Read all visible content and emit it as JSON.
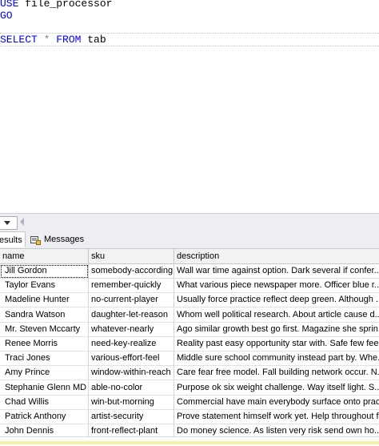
{
  "editor": {
    "line1": {
      "keyword": "USE",
      "rest": " file_processor"
    },
    "line2": {
      "keyword": "GO"
    },
    "line3": {
      "keyword1": "SELECT",
      "star": " * ",
      "keyword2": "FROM",
      "rest": " tab"
    }
  },
  "zoom": {
    "icon": "chevron-down-icon"
  },
  "tabs": {
    "results_label": "esults",
    "messages_label": "Messages",
    "messages_icon": "messages-icon"
  },
  "grid": {
    "columns": [
      "name",
      "sku",
      "description"
    ],
    "rows": [
      {
        "name": "Jill Gordon",
        "sku": "somebody-according",
        "description": "Wall war time against option. Dark several if confer..."
      },
      {
        "name": "Taylor Evans",
        "sku": "remember-quickly",
        "description": "What various piece newspaper more. Officer blue r..."
      },
      {
        "name": "Madeline Hunter",
        "sku": "no-current-player",
        "description": "Usually force practice reflect deep green. Although ..."
      },
      {
        "name": "Sandra Watson",
        "sku": "daughter-let-reason",
        "description": "Whom well political research. About article cause d..."
      },
      {
        "name": "Mr. Steven Mccarty",
        "sku": "whatever-nearly",
        "description": "Ago similar growth best go first. Magazine she sprin..."
      },
      {
        "name": "Renee Morris",
        "sku": "need-key-realize",
        "description": "Reality past easy opportunity star with. Safe few fee..."
      },
      {
        "name": "Traci Jones",
        "sku": "various-effort-feel",
        "description": "Middle sure school community instead part by. Whe..."
      },
      {
        "name": "Amy Prince",
        "sku": "window-within-reach",
        "description": "Care fear free model. Fall building network occur. N..."
      },
      {
        "name": "Stephanie Glenn MD",
        "sku": "able-no-color",
        "description": "Purpose ok six weight challenge. Way itself light. S..."
      },
      {
        "name": "Chad Willis",
        "sku": "win-but-morning",
        "description": "Commercial have main everybody surface onto prac..."
      },
      {
        "name": "Patrick Anthony",
        "sku": "artist-security",
        "description": "Prove statement himself work yet. Help throughout f..."
      },
      {
        "name": "John Dennis",
        "sku": "front-reflect-plant",
        "description": "Do money science. As listen very risk send own ho..."
      }
    ]
  },
  "colors": {
    "keyword": "#0000ff",
    "operator": "#808080",
    "tab_strip": "#eeeef2",
    "status_warning": "#f5f1a6"
  }
}
